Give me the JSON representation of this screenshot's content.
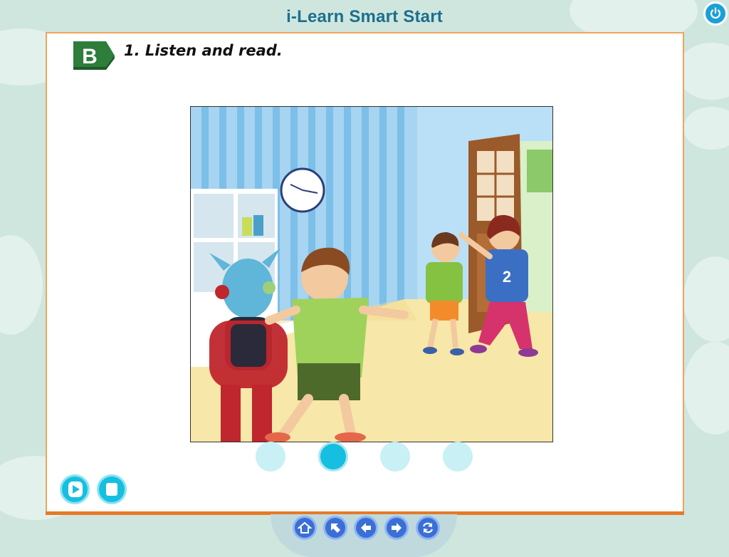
{
  "app": {
    "title": "i-Learn Smart Start"
  },
  "section": {
    "badge": "B",
    "heading": "1. Listen and read."
  },
  "illustration": {
    "jersey_number": "2"
  },
  "player": {
    "play": "play-icon",
    "stop": "stop-icon"
  },
  "pages": {
    "count": 4,
    "active": 2
  },
  "nav": {
    "icons": [
      "home-icon",
      "arrow-up-left-icon",
      "arrow-left-icon",
      "arrow-right-icon",
      "refresh-icon"
    ]
  },
  "colors": {
    "accent": "#16bfe0",
    "panel_border": "#f0a45c",
    "badge_green": "#2e7d3a",
    "nav_blue": "#3b6fd6"
  }
}
